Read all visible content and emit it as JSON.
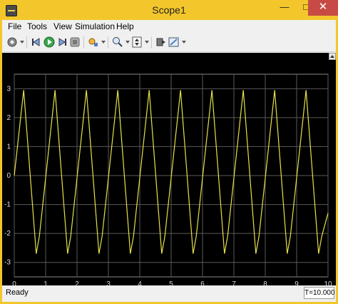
{
  "window": {
    "title": "Scope1"
  },
  "menu": [
    {
      "label": "File"
    },
    {
      "label": "Tools"
    },
    {
      "label": "View"
    },
    {
      "label": "Simulation"
    },
    {
      "label": "Help"
    }
  ],
  "toolbar": {
    "icons": [
      "settings-icon",
      "step-back-icon",
      "run-icon",
      "step-forward-icon",
      "stop-icon",
      "highlight-icon",
      "zoom-icon",
      "scale-axes-icon",
      "cursor-measurement-icon",
      "style-icon"
    ]
  },
  "status": {
    "text": "Ready",
    "time": "T=10.000"
  },
  "chart_data": {
    "type": "line",
    "title": "",
    "xlabel": "",
    "ylabel": "",
    "xlim": [
      0,
      10
    ],
    "ylim": [
      -3.5,
      3.5
    ],
    "xticks": [
      "0",
      "1",
      "2",
      "3",
      "4",
      "5",
      "6",
      "7",
      "8",
      "9",
      "10"
    ],
    "yticks": [
      "3",
      "2",
      "1",
      "0",
      "-1",
      "-2",
      "-3"
    ],
    "grid": true,
    "background": "#000000",
    "line_color": "#e6e24a",
    "series": [
      {
        "x": [
          0,
          0.3,
          0.7,
          0.8,
          1.3,
          1.7,
          1.8,
          2.3,
          2.7,
          2.8,
          3.3,
          3.7,
          3.8,
          4.3,
          4.7,
          4.8,
          5.3,
          5.7,
          5.8,
          6.3,
          6.7,
          6.8,
          7.3,
          7.7,
          7.8,
          8.3,
          8.7,
          8.8,
          9.3,
          9.7,
          9.8,
          10
        ],
        "y": [
          0,
          2.95,
          -2.7,
          -2.1,
          2.95,
          -2.7,
          -2.1,
          2.95,
          -2.7,
          -2.1,
          2.95,
          -2.7,
          -2.1,
          2.95,
          -2.7,
          -2.1,
          2.95,
          -2.7,
          -2.1,
          2.95,
          -2.7,
          -2.1,
          2.95,
          -2.7,
          -2.1,
          2.95,
          -2.7,
          -2.1,
          2.95,
          -2.7,
          -2.1,
          -1.3
        ]
      }
    ]
  }
}
